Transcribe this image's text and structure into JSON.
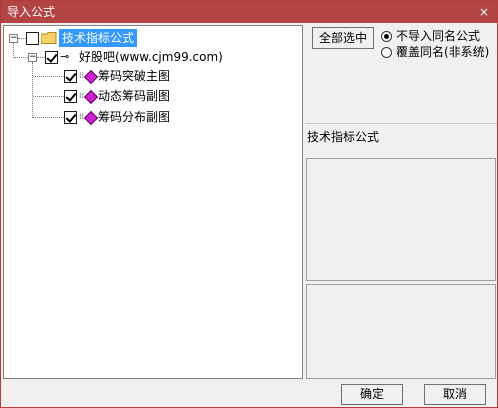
{
  "window": {
    "title": "导入公式",
    "close": "×"
  },
  "tree": {
    "root": {
      "label": "技术指标公式",
      "checked": false,
      "expander": "−"
    },
    "group": {
      "label": "好股吧(www.cjm99.com)",
      "checked": true,
      "expander": "−"
    },
    "items": [
      {
        "label": "筹码突破主图",
        "checked": true
      },
      {
        "label": "动态筹码副图",
        "checked": true
      },
      {
        "label": "筹码分布副图",
        "checked": true
      }
    ]
  },
  "right": {
    "select_all_label": "全部选中",
    "options": [
      {
        "label": "不导入同名公式",
        "selected": true
      },
      {
        "label": "覆盖同名(非系统)",
        "selected": false
      }
    ],
    "section_label": "技术指标公式"
  },
  "buttons": {
    "ok": "确定",
    "cancel": "取消"
  }
}
